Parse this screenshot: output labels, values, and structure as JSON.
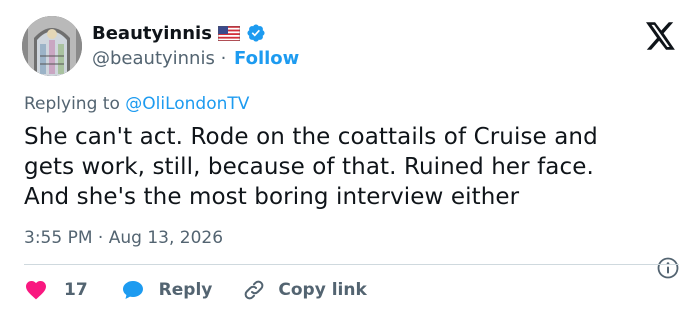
{
  "user": {
    "display_name": "Beautyinnis",
    "handle": "@beautyinnis",
    "follow_label": "Follow"
  },
  "tweet": {
    "replying_prefix": "Replying to",
    "replying_to": "@OliLondonTV",
    "text": "She can't act. Rode on the coattails of Cruise and\ngets work, still, because of that. Ruined her face.\nAnd she's the most boring interview either",
    "time": "3:55 PM",
    "date": "Aug 13, 2026"
  },
  "actions": {
    "like_count": "17",
    "reply_label": "Reply",
    "copy_label": "Copy link"
  },
  "colors": {
    "accent": "#1d9bf0",
    "like": "#f91880",
    "secondary_text": "#536471"
  },
  "icons": {
    "avatar": "stained-glass-window",
    "flag": "us-flag-icon",
    "verified": "verified-badge-icon",
    "logo": "x-logo-icon",
    "info": "info-icon",
    "like": "heart-icon",
    "reply": "speech-bubble-icon",
    "copy": "link-icon"
  }
}
